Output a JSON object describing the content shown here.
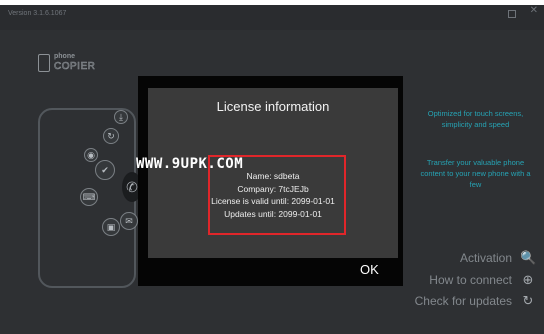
{
  "window": {
    "title": "Version 3.1.6.1067",
    "close_glyph": "✕"
  },
  "logo": {
    "line1": "phone",
    "line2": "COPIER"
  },
  "phone": {
    "icons": [
      "check-icon",
      "sync-icon",
      "keyboard-icon",
      "image-icon",
      "phone-icon",
      "email-icon",
      "camera-icon",
      "download-icon"
    ],
    "glyphs": [
      "✔",
      "↻",
      "⌨",
      "▣",
      "✆",
      "✉",
      "◉",
      "⤓"
    ]
  },
  "side_text": {
    "block1": "Optimized for touch screens, simplicity and speed",
    "block2": "Transfer your valuable phone content to your new phone with a few"
  },
  "menu": {
    "activation": "Activation",
    "how_to_connect": "How to connect",
    "check_updates": "Check for updates",
    "activation_icon": "🔍",
    "connect_icon": "⊕",
    "updates_icon": "↻"
  },
  "dialog": {
    "title": "License information",
    "name": "Name: sdbeta",
    "company": "Company: 7tcJEJb",
    "valid_until": "License is valid until: 2099-01-01",
    "updates_until": "Updates until: 2099-01-01",
    "ok": "OK",
    "highlight_color": "#e0262a"
  },
  "watermark": "WWW.9UPK.COM"
}
